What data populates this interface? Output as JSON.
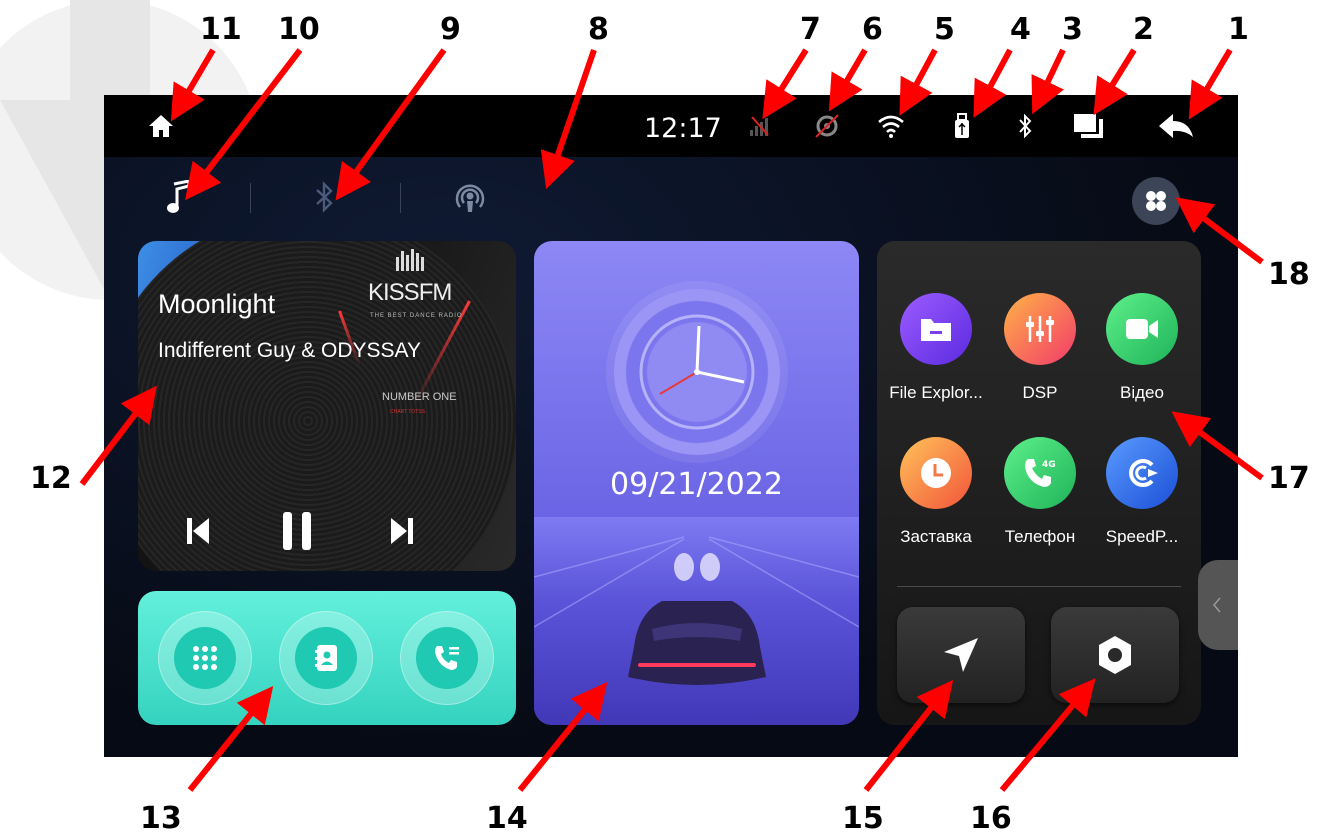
{
  "callouts": [
    "1",
    "2",
    "3",
    "4",
    "5",
    "6",
    "7",
    "8",
    "9",
    "10",
    "11",
    "12",
    "13",
    "14",
    "15",
    "16",
    "17",
    "18"
  ],
  "status_bar": {
    "time": "12:17",
    "icons": [
      "back-arrow-icon",
      "recent-apps-icon",
      "bluetooth-icon",
      "usb-icon",
      "wifi-icon",
      "gps-off-icon",
      "no-signal-icon",
      "home-icon"
    ]
  },
  "source_tabs": [
    "music-note-icon",
    "bluetooth-audio-icon",
    "radio-icon"
  ],
  "music": {
    "title": "Moonlight",
    "artist": "Indifferent Guy & ODYSSAY",
    "art_logo": "KISSFM",
    "art_sub": "THE BEST DANCE RADIO",
    "art_number": "NUMBER ONE",
    "art_chart": "CHART TOTSS"
  },
  "clock": {
    "date": "09/21/2022"
  },
  "apps": [
    {
      "label": "File Explor...",
      "icon": "folder-icon",
      "color": "#7b3ff0"
    },
    {
      "label": "DSP",
      "icon": "equalizer-icon",
      "color": "#f25b5b"
    },
    {
      "label": "Відео",
      "icon": "video-camera-icon",
      "color": "#2fcf6a"
    },
    {
      "label": "Заставка",
      "icon": "clock-icon",
      "color": "#f27a4a"
    },
    {
      "label": "Телефон",
      "icon": "phone-4g-icon",
      "color": "#2fcf6a"
    },
    {
      "label": "SpeedP...",
      "icon": "speedplay-icon",
      "color": "#2a6ef0"
    }
  ],
  "colors": {
    "screen_bg": "#070b14",
    "callout_arrow": "#ff0000",
    "phone_card": "#34d3bf",
    "clock_card": "#6c66e6"
  }
}
